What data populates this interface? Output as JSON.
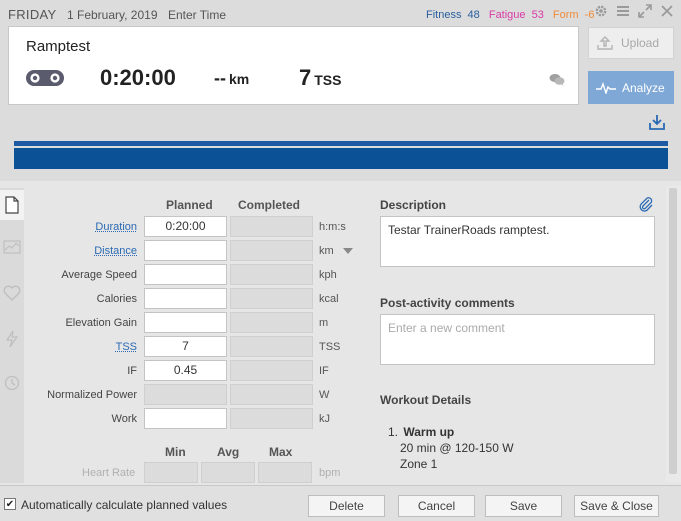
{
  "header": {
    "day": "FRIDAY",
    "date": "1 February, 2019",
    "enter_time": "Enter Time",
    "fitness_label": "Fitness",
    "fitness_value": "48",
    "fatigue_label": "Fatigue",
    "fatigue_value": "53",
    "form_label": "Form",
    "form_value": "-6"
  },
  "summary": {
    "title": "Ramptest",
    "duration": "0:20:00",
    "distance": "--",
    "distance_unit": "km",
    "tss": "7",
    "tss_unit": "TSS"
  },
  "actions": {
    "upload_label": "Upload",
    "analyze_label": "Analyze"
  },
  "colors": {
    "chart_top": "#1d5aa3",
    "chart_band": "#0b5195",
    "analyze_bg": "#7fa8d6",
    "fitness": "#2b5fa0",
    "fatigue": "#d93aa6",
    "form": "#f08a38"
  },
  "form": {
    "planned_header": "Planned",
    "completed_header": "Completed",
    "rows": {
      "duration": {
        "label": "Duration",
        "planned": "0:20:00",
        "completed": "",
        "unit": "h:m:s"
      },
      "distance": {
        "label": "Distance",
        "planned": "",
        "completed": "",
        "unit": "km"
      },
      "avg_speed": {
        "label": "Average Speed",
        "planned": "",
        "completed": "",
        "unit": "kph"
      },
      "calories": {
        "label": "Calories",
        "planned": "",
        "completed": "",
        "unit": "kcal"
      },
      "elevation": {
        "label": "Elevation Gain",
        "planned": "",
        "completed": "",
        "unit": "m"
      },
      "tss": {
        "label": "TSS",
        "planned": "7",
        "completed": "",
        "unit": "TSS"
      },
      "if": {
        "label": "IF",
        "planned": "0.45",
        "completed": "",
        "unit": "IF"
      },
      "np": {
        "label": "Normalized Power",
        "planned": "",
        "completed": "",
        "unit": "W"
      },
      "work": {
        "label": "Work",
        "planned": "",
        "completed": "",
        "unit": "kJ"
      }
    },
    "min_header": "Min",
    "avg_header": "Avg",
    "max_header": "Max",
    "heart_rate": {
      "label": "Heart Rate",
      "unit": "bpm"
    }
  },
  "description": {
    "title": "Description",
    "text": "Testar TrainerRoads ramptest."
  },
  "comments": {
    "title": "Post-activity comments",
    "placeholder": "Enter a new comment"
  },
  "workout_details": {
    "title": "Workout Details",
    "steps": [
      {
        "num": "1.",
        "title": "Warm up",
        "lines": [
          "20 min @ 120-150 W",
          "Zone 1"
        ]
      }
    ]
  },
  "footer": {
    "auto_calc_label": "Automatically calculate planned values",
    "auto_calc_checked": true,
    "delete_label": "Delete",
    "cancel_label": "Cancel",
    "save_label": "Save",
    "save_close_label": "Save & Close"
  }
}
